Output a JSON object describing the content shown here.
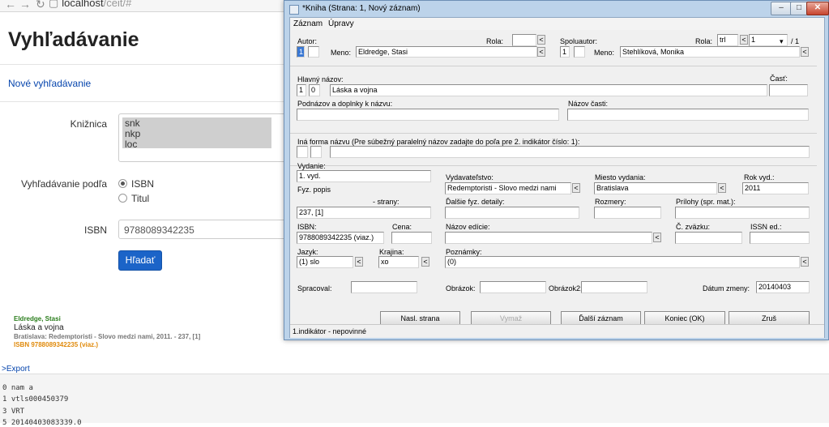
{
  "browser": {
    "url_host": "localhost",
    "url_path": "/ceit/#"
  },
  "page": {
    "title": "Vyhľadávanie",
    "new_search": "Nové vyhľadávanie",
    "library_label": "Knižnica",
    "libraries": [
      "snk",
      "nkp",
      "loc"
    ],
    "search_by_label": "Vyhľadávanie podľa",
    "options": [
      {
        "label": "ISBN",
        "selected": true
      },
      {
        "label": "Titul",
        "selected": false
      }
    ],
    "isbn_label": "ISBN",
    "isbn_value": "9788089342235",
    "search_button": "Hľadať"
  },
  "result": {
    "author": "Eldredge, Stasi",
    "title": "Láska a vojna",
    "publication": "Bratislava: Redemptoristi - Slovo medzi nami, 2011. - 237, [1]",
    "isbn": "ISBN 9788089342235 (viaz.)",
    "export": ">Export",
    "marc_lines": [
      "0 nam  a",
      "1 vtls000450379",
      "3 VRT",
      "5 20140403083339.0"
    ]
  },
  "dialog": {
    "title": "*Kniha (Strana: 1, Nový záznam)",
    "menu": [
      "Záznam",
      "Úpravy"
    ],
    "labels": {
      "autor": "Autor:",
      "rola": "Rola:",
      "meno": "Meno:",
      "spoluautor": "Spoluautor:",
      "rola2": "Rola:",
      "meno2": "Meno:",
      "hlavny_nazov": "Hlavný názov:",
      "cast": "Časť:",
      "podnazov": "Podnázov a doplnky k názvu:",
      "nazov_casti": "Názov časti:",
      "ina_forma": "Iná forma názvu (Pre súbežný paralelný názov zadajte do poľa pre 2. indikátor číslo: 1):",
      "vydanie": "Vydanie:",
      "vydavatelstvo": "Vydavateľstvo:",
      "miesto": "Miesto vydania:",
      "rok": "Rok vyd.:",
      "fyz_popis": "Fyz. popis",
      "strany": "- strany:",
      "dalsie_fyz": "Ďalšie fyz. detaily:",
      "rozmery": "Rozmery:",
      "prilohy": "Prílohy (spr. mat.):",
      "isbn": "ISBN:",
      "cena": "Cena:",
      "nazov_edicie": "Názov edície:",
      "c_zvazku": "Č. zväzku:",
      "issn": "ISSN ed.:",
      "jazyk": "Jazyk:",
      "krajina": "Krajina:",
      "poznamky": "Poznámky:",
      "spracoval": "Spracoval:",
      "obrazok": "Obrázok:",
      "obrazok2": "Obrázok2:",
      "datum_zmeny": "Dátum zmeny:"
    },
    "values": {
      "autor_ind1": "1",
      "autor_meno": "Eldredge, Stasi",
      "spoluautor_ind1": "1",
      "spoluautor_meno": "Stehlíková, Monika",
      "rola2_value": "trl",
      "rola2_index": "1",
      "rola2_total": "/ 1",
      "hlavny_ind1": "1",
      "hlavny_ind2": "0",
      "hlavny_nazov": "Láska a vojna",
      "vydanie": "1. vyd.",
      "vydavatelstvo": "Redemptoristi - Slovo medzi nami",
      "miesto": "Bratislava",
      "rok": "2011",
      "strany": "237, [1]",
      "isbn": "9788089342235 (viaz.)",
      "jazyk": "(1) slo",
      "krajina": "xo",
      "poznamky": "(0)",
      "datum_zmeny": "20140403"
    },
    "buttons": {
      "nasl_strana": "Nasl. strana",
      "vymaz": "Vymaž",
      "dalsi_zaznam": "Ďalší záznam",
      "koniec": "Koniec (OK)",
      "zrus": "Zruš"
    },
    "status": "1.indikátor - nepovinné",
    "window_buttons": [
      "–",
      "□",
      "✕"
    ]
  }
}
